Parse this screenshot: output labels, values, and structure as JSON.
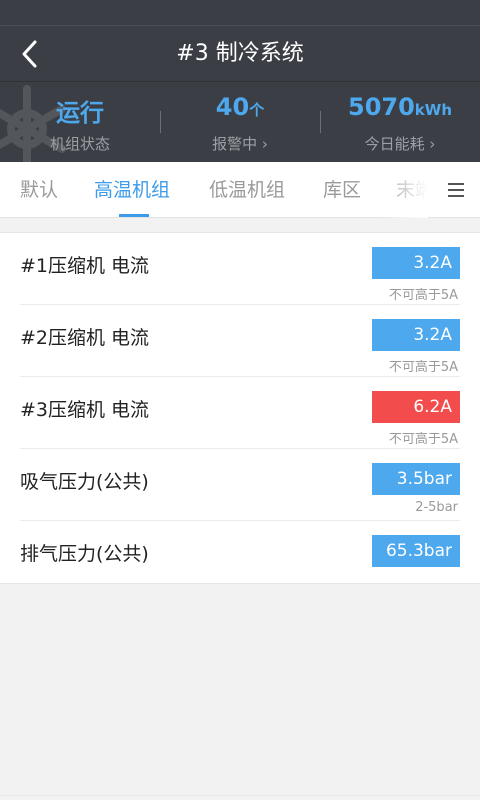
{
  "header": {
    "title": "#3 制冷系统",
    "back_icon": "back-arrow-icon",
    "watermark_icon": "snowflake-icon"
  },
  "stats": [
    {
      "value": "运行",
      "unit": "",
      "label": "机组状态"
    },
    {
      "value": "40",
      "unit": "个",
      "label": "报警中 ›"
    },
    {
      "value": "5070",
      "unit": "kWh",
      "label": "今日能耗 ›"
    }
  ],
  "tabs": [
    {
      "label": "默认"
    },
    {
      "label": "高温机组"
    },
    {
      "label": "低温机组"
    },
    {
      "label": "库区"
    },
    {
      "label": "末端"
    }
  ],
  "active_tab": "高温机组",
  "menu_icon": "hamburger-menu-icon",
  "items": [
    {
      "name": "#1压缩机 电流",
      "value": "3.2A",
      "limit": "不可高于5A",
      "status": "normal"
    },
    {
      "name": "#2压缩机 电流",
      "value": "3.2A",
      "limit": "不可高于5A",
      "status": "normal"
    },
    {
      "name": "#3压缩机 电流",
      "value": "6.2A",
      "limit": "不可高于5A",
      "status": "alarm"
    },
    {
      "name": "吸气压力(公共)",
      "value": "3.5bar",
      "limit": "2-5bar",
      "status": "normal"
    },
    {
      "name": "排气压力(公共)",
      "value": "65.3bar",
      "limit": "",
      "status": "normal"
    }
  ],
  "colors": {
    "header_bg": "#3b3f45",
    "accent": "#3d9be9",
    "value_normal": "#4da8ee",
    "value_alarm": "#f24c4c"
  }
}
